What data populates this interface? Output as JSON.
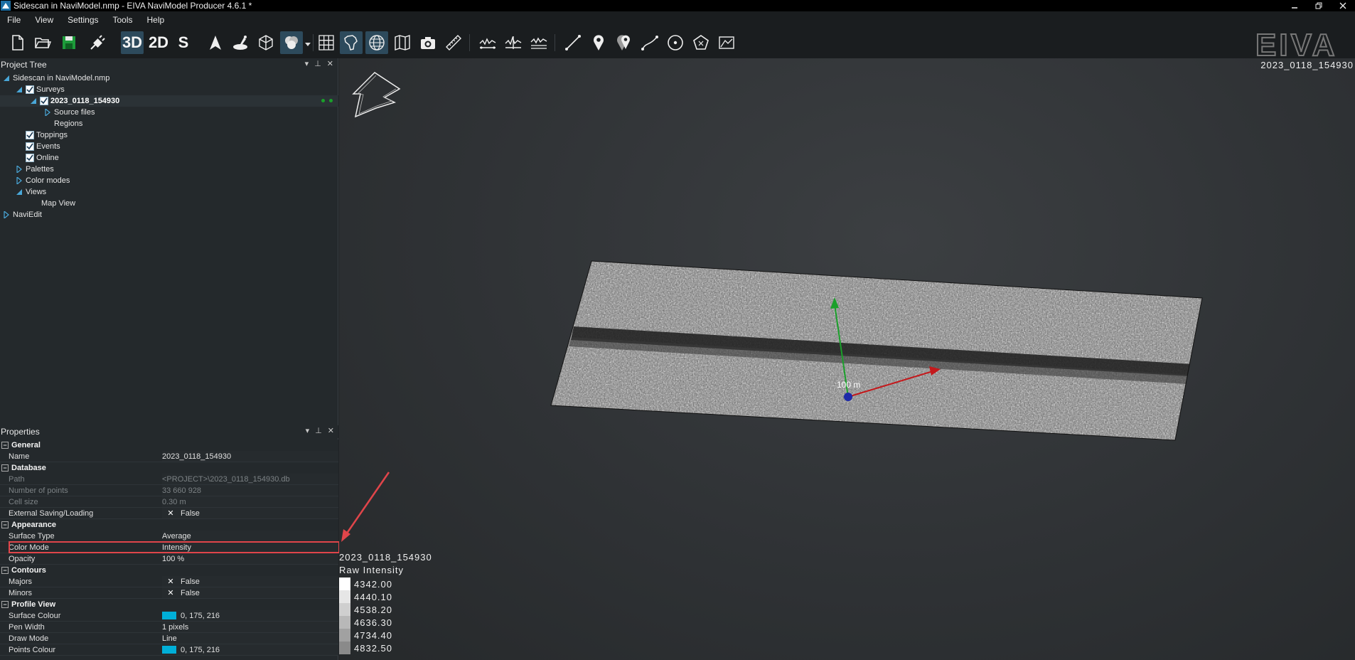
{
  "window": {
    "title": "Sidescan in NaviModel.nmp - EIVA NaviModel Producer 4.6.1 *",
    "icon": "navimodel-app-icon",
    "controls": [
      "minimize",
      "restore",
      "close"
    ]
  },
  "menu": {
    "items": [
      "File",
      "View",
      "Settings",
      "Tools",
      "Help"
    ]
  },
  "toolbar": {
    "mode_3d": "3D",
    "mode_2d": "2D",
    "mode_s": "S",
    "brand": "EIVA"
  },
  "project_tree": {
    "title": "Project Tree",
    "root": "Sidescan in NaviModel.nmp",
    "surveys": "Surveys",
    "survey_item": "2023_0118_154930",
    "source_files": "Source files",
    "regions": "Regions",
    "toppings": "Toppings",
    "events": "Events",
    "online": "Online",
    "palettes": "Palettes",
    "color_modes": "Color modes",
    "views": "Views",
    "map_view": "Map View",
    "naviedit": "NaviEdit"
  },
  "properties": {
    "title": "Properties",
    "general": {
      "label": "General",
      "name_label": "Name",
      "name_value": "2023_0118_154930"
    },
    "database": {
      "label": "Database",
      "path_label": "Path",
      "path_value": "<PROJECT>\\2023_0118_154930.db",
      "points_label": "Number of points",
      "points_value": "33 660 928",
      "cell_label": "Cell size",
      "cell_value": "0.30 m",
      "ext_label": "External Saving/Loading",
      "ext_value": "False"
    },
    "appearance": {
      "label": "Appearance",
      "surface_label": "Surface Type",
      "surface_value": "Average",
      "color_mode_label": "Color Mode",
      "color_mode_value": "Intensity",
      "opacity_label": "Opacity",
      "opacity_value": "100 %"
    },
    "contours": {
      "label": "Contours",
      "majors_label": "Majors",
      "majors_value": "False",
      "minors_label": "Minors",
      "minors_value": "False"
    },
    "profile_view": {
      "label": "Profile View",
      "surface_colour_label": "Surface Colour",
      "surface_colour_value": "0, 175, 216",
      "pen_width_label": "Pen Width",
      "pen_width_value": "1 pixels",
      "draw_mode_label": "Draw Mode",
      "draw_mode_value": "Line",
      "points_colour_label": "Points Colour",
      "points_colour_value": "0, 175, 216"
    }
  },
  "viewport": {
    "corner_label": "2023_0118_154930",
    "scale_label": "100 m",
    "legend_title": "2023_0118_154930",
    "legend_subtitle": "Raw Intensity",
    "legend_values": [
      "4342.00",
      "4440.10",
      "4538.20",
      "4636.30",
      "4734.40",
      "4832.50"
    ],
    "legend_colors": [
      "#ffffff",
      "#e6e6e6",
      "#cfcfcf",
      "#b8b8b8",
      "#a1a1a1",
      "#8a8a8a"
    ]
  },
  "colors": {
    "accent": "#00afd8",
    "annotation": "#e0454a"
  }
}
